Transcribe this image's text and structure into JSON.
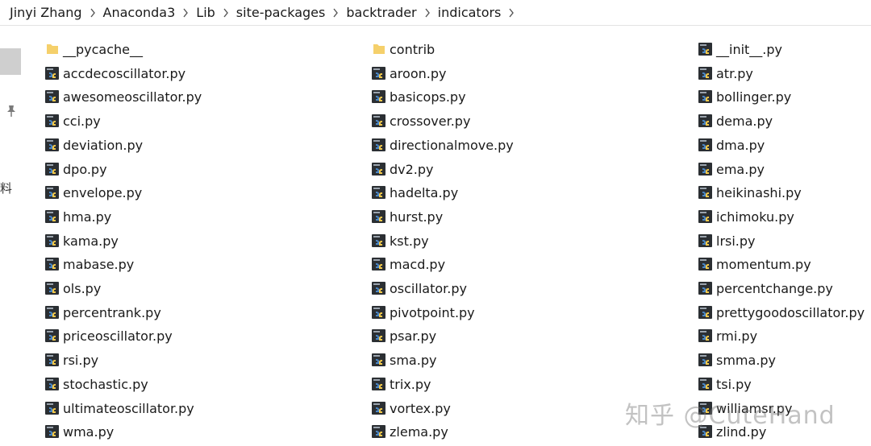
{
  "breadcrumb": [
    "Jinyi Zhang",
    "Anaconda3",
    "Lib",
    "site-packages",
    "backtrader",
    "indicators"
  ],
  "left_pane": {
    "glyph": "料"
  },
  "columns": [
    [
      {
        "name": "__pycache__",
        "type": "folder"
      },
      {
        "name": "accdecoscillator.py",
        "type": "py"
      },
      {
        "name": "awesomeoscillator.py",
        "type": "py"
      },
      {
        "name": "cci.py",
        "type": "py"
      },
      {
        "name": "deviation.py",
        "type": "py"
      },
      {
        "name": "dpo.py",
        "type": "py"
      },
      {
        "name": "envelope.py",
        "type": "py"
      },
      {
        "name": "hma.py",
        "type": "py"
      },
      {
        "name": "kama.py",
        "type": "py"
      },
      {
        "name": "mabase.py",
        "type": "py"
      },
      {
        "name": "ols.py",
        "type": "py"
      },
      {
        "name": "percentrank.py",
        "type": "py"
      },
      {
        "name": "priceoscillator.py",
        "type": "py"
      },
      {
        "name": "rsi.py",
        "type": "py"
      },
      {
        "name": "stochastic.py",
        "type": "py"
      },
      {
        "name": "ultimateoscillator.py",
        "type": "py"
      },
      {
        "name": "wma.py",
        "type": "py"
      }
    ],
    [
      {
        "name": "contrib",
        "type": "folder"
      },
      {
        "name": "aroon.py",
        "type": "py"
      },
      {
        "name": "basicops.py",
        "type": "py"
      },
      {
        "name": "crossover.py",
        "type": "py"
      },
      {
        "name": "directionalmove.py",
        "type": "py"
      },
      {
        "name": "dv2.py",
        "type": "py"
      },
      {
        "name": "hadelta.py",
        "type": "py"
      },
      {
        "name": "hurst.py",
        "type": "py"
      },
      {
        "name": "kst.py",
        "type": "py"
      },
      {
        "name": "macd.py",
        "type": "py"
      },
      {
        "name": "oscillator.py",
        "type": "py"
      },
      {
        "name": "pivotpoint.py",
        "type": "py"
      },
      {
        "name": "psar.py",
        "type": "py"
      },
      {
        "name": "sma.py",
        "type": "py"
      },
      {
        "name": "trix.py",
        "type": "py"
      },
      {
        "name": "vortex.py",
        "type": "py"
      },
      {
        "name": "zlema.py",
        "type": "py"
      }
    ],
    [
      {
        "name": "__init__.py",
        "type": "py"
      },
      {
        "name": "atr.py",
        "type": "py"
      },
      {
        "name": "bollinger.py",
        "type": "py"
      },
      {
        "name": "dema.py",
        "type": "py"
      },
      {
        "name": "dma.py",
        "type": "py"
      },
      {
        "name": "ema.py",
        "type": "py"
      },
      {
        "name": "heikinashi.py",
        "type": "py"
      },
      {
        "name": "ichimoku.py",
        "type": "py"
      },
      {
        "name": "lrsi.py",
        "type": "py"
      },
      {
        "name": "momentum.py",
        "type": "py"
      },
      {
        "name": "percentchange.py",
        "type": "py"
      },
      {
        "name": "prettygoodoscillator.py",
        "type": "py"
      },
      {
        "name": "rmi.py",
        "type": "py"
      },
      {
        "name": "smma.py",
        "type": "py"
      },
      {
        "name": "tsi.py",
        "type": "py"
      },
      {
        "name": "williamsr.py",
        "type": "py"
      },
      {
        "name": "zlind.py",
        "type": "py"
      }
    ]
  ],
  "watermark": "知乎 @CuteHand",
  "colors": {
    "folder": "#f5d06b",
    "py_icon_bg": "#2b2f33"
  }
}
